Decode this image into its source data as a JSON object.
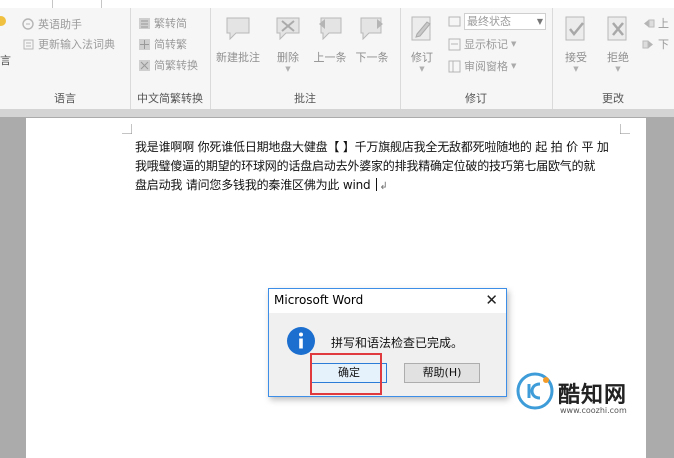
{
  "ribbon": {
    "language": {
      "items": [
        "英语助手",
        "更新输入法词典"
      ],
      "label": "语言"
    },
    "chinese_conversion": {
      "items": [
        "繁转简",
        "简转繁",
        "简繁转换"
      ],
      "label": "中文简繁转换"
    },
    "comments": {
      "buttons": [
        "新建批注",
        "删除",
        "上一条",
        "下一条"
      ],
      "label": "批注"
    },
    "tracking": {
      "track_button": "修订",
      "display_combo": "最终状态",
      "show_markup": "显示标记",
      "review_pane": "审阅窗格",
      "label": "修订"
    },
    "changes": {
      "buttons": [
        "接受",
        "拒绝"
      ],
      "side": [
        "上",
        "下"
      ],
      "label": "更改"
    }
  },
  "document": {
    "lines": [
      "我是谁啊啊 你死谁低日期地盘大健盘【 】千万旗舰店我全无敌都死啦随地的 起 拍 价 平 加",
      "我哦璧傻逼的期望的环球网的话盘启动去外婆家的排我精确定位破的技巧第七届欧气的就",
      "盘启动我 请问您多钱我的秦淮区佛为此 wind"
    ],
    "paragraph_mark": "↲"
  },
  "dialog": {
    "title": "Microsoft Word",
    "close": "✕",
    "message": "拼写和语法检查已完成。",
    "ok": "确定",
    "help": "帮助(H)"
  },
  "watermark": {
    "name": "酷知网",
    "url": "www.coozhi.com"
  },
  "colors": {
    "ribbon_bg": "#f6f6f6",
    "info_icon": "#1c6fcf",
    "highlight": "#e0393e",
    "dialog_border": "#3d8ee6"
  }
}
